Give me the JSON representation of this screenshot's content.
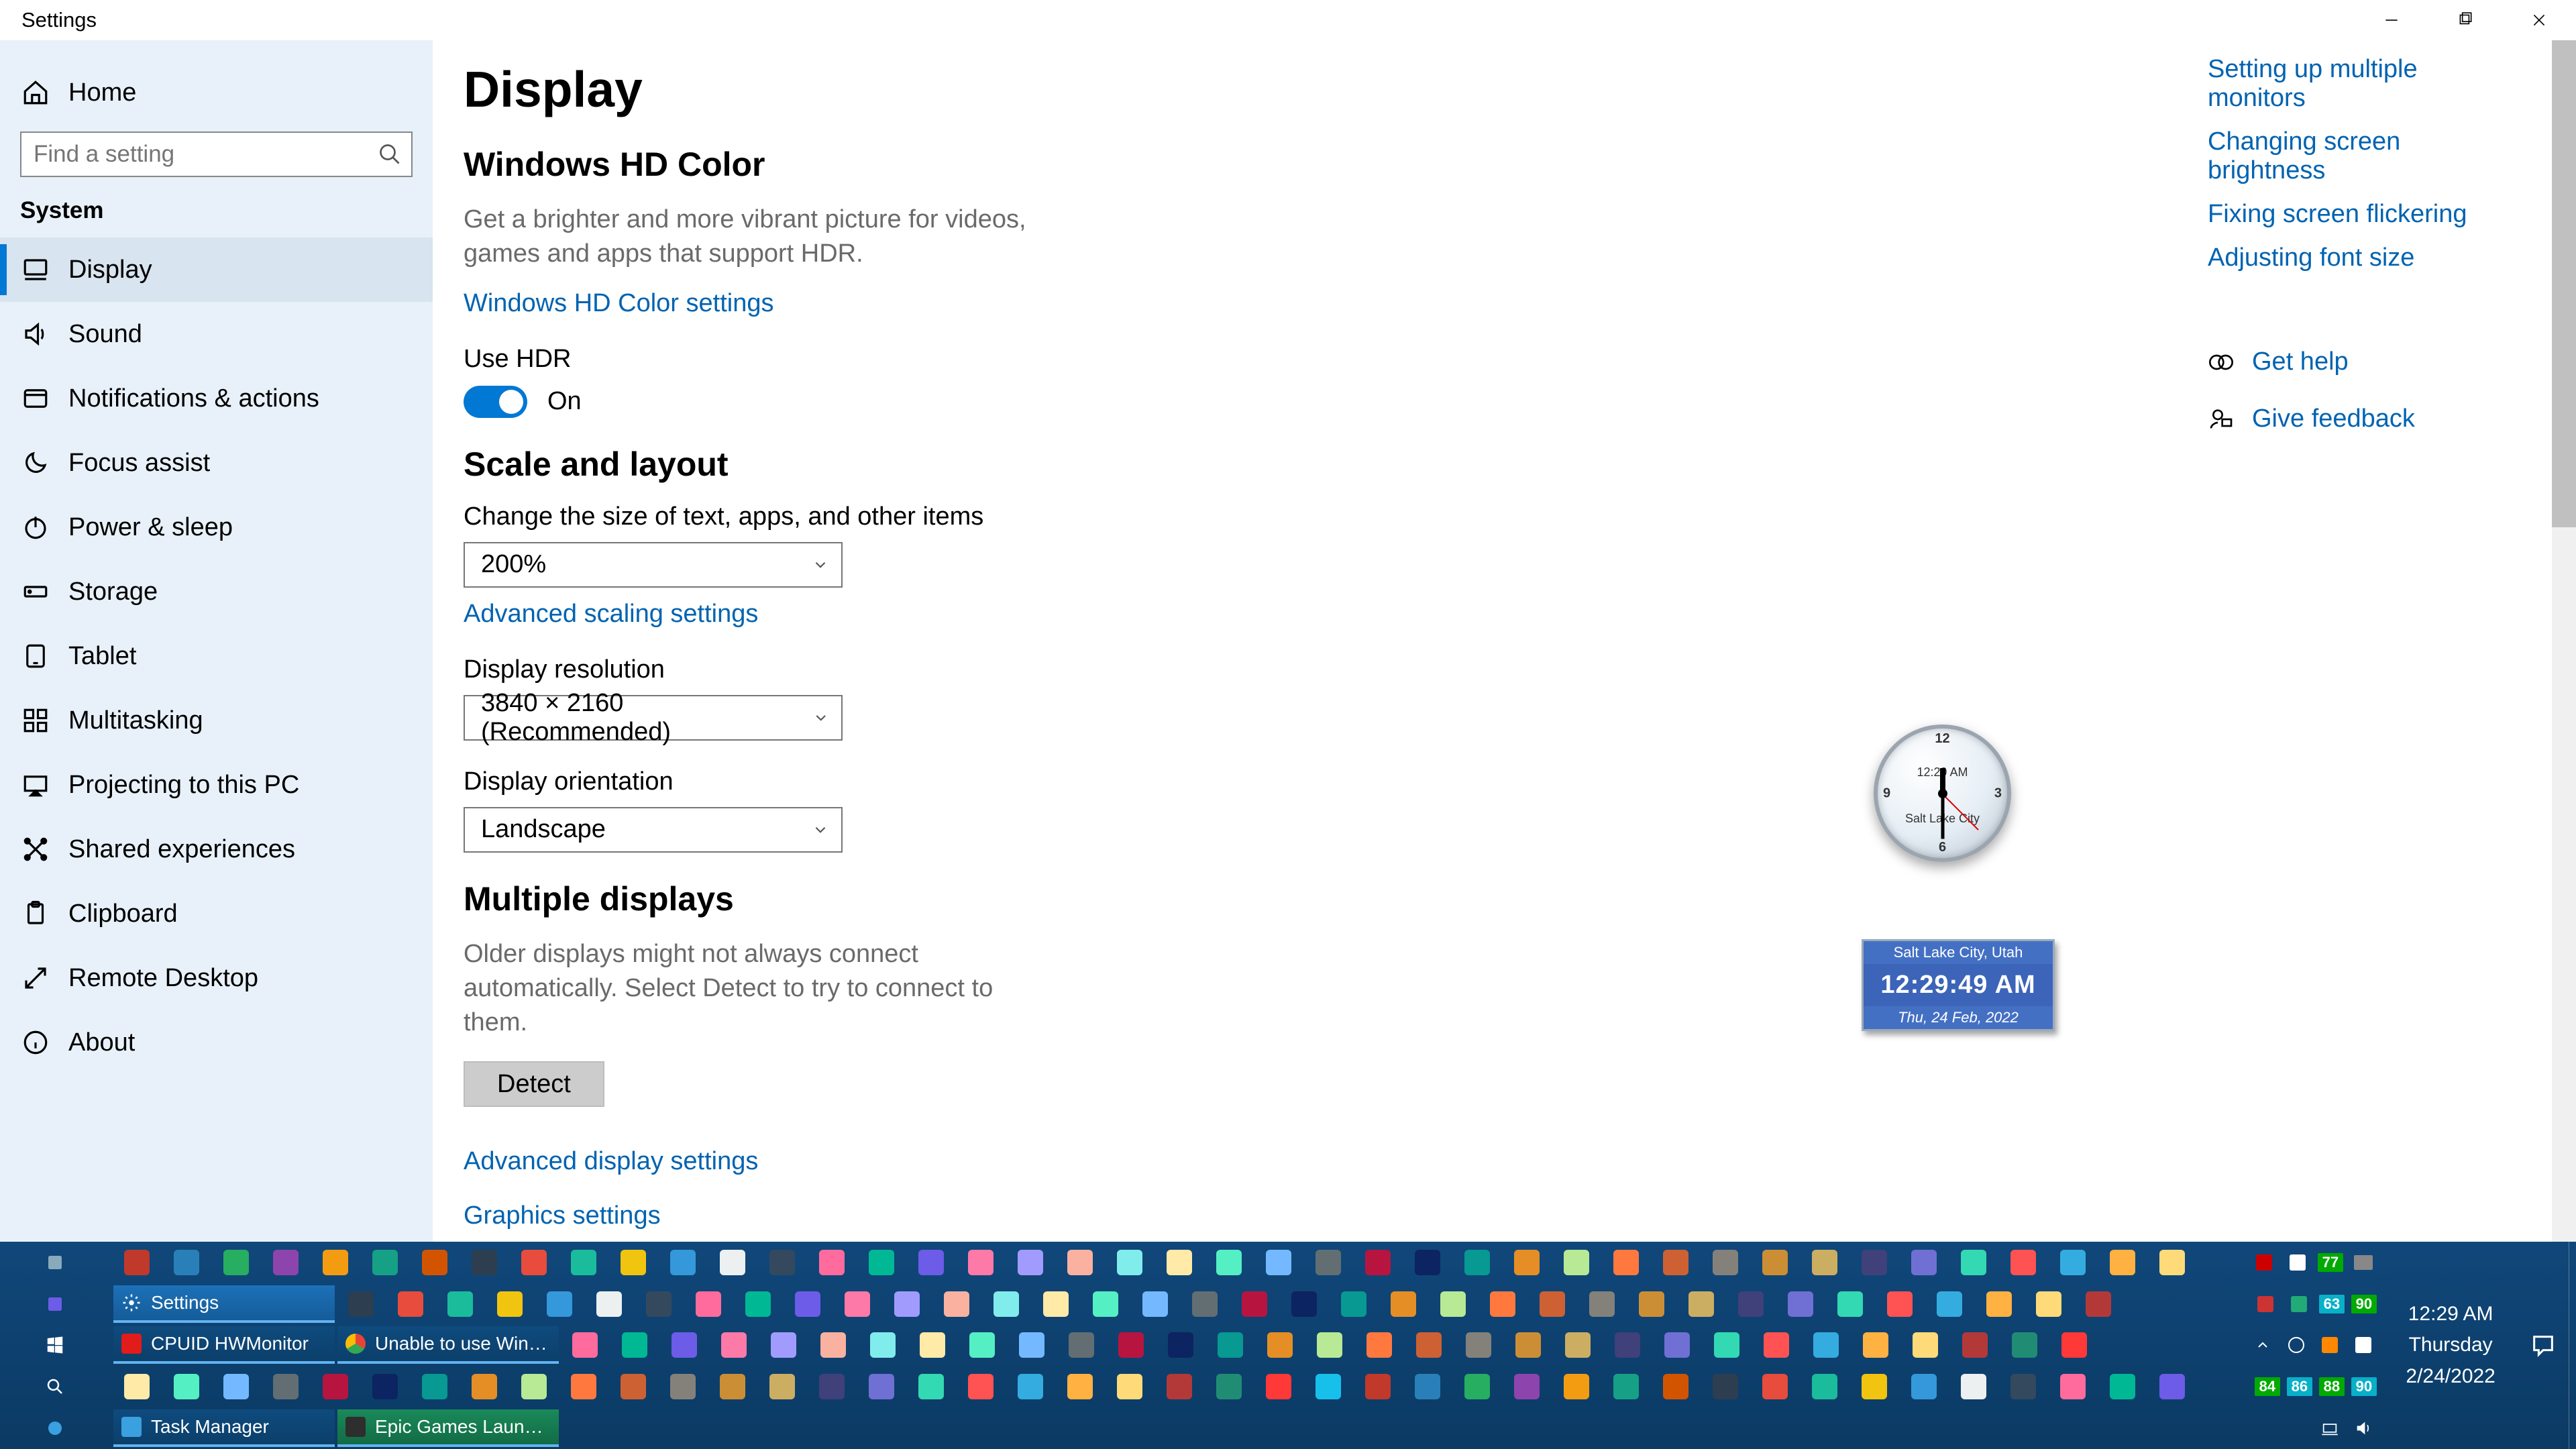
{
  "window": {
    "title": "Settings"
  },
  "sidebar": {
    "home": "Home",
    "search_placeholder": "Find a setting",
    "section": "System",
    "items": [
      {
        "label": "Display",
        "icon": "monitor",
        "active": true
      },
      {
        "label": "Sound",
        "icon": "sound"
      },
      {
        "label": "Notifications & actions",
        "icon": "notifications"
      },
      {
        "label": "Focus assist",
        "icon": "moon"
      },
      {
        "label": "Power & sleep",
        "icon": "power"
      },
      {
        "label": "Storage",
        "icon": "storage"
      },
      {
        "label": "Tablet",
        "icon": "tablet"
      },
      {
        "label": "Multitasking",
        "icon": "multitasking"
      },
      {
        "label": "Projecting to this PC",
        "icon": "projecting"
      },
      {
        "label": "Shared experiences",
        "icon": "shared"
      },
      {
        "label": "Clipboard",
        "icon": "clipboard"
      },
      {
        "label": "Remote Desktop",
        "icon": "remote"
      },
      {
        "label": "About",
        "icon": "info"
      }
    ]
  },
  "page": {
    "title": "Display",
    "hdr": {
      "heading": "Windows HD Color",
      "desc": "Get a brighter and more vibrant picture for videos, games and apps that support HDR.",
      "link": "Windows HD Color settings",
      "toggle_label": "Use HDR",
      "toggle_state": "On"
    },
    "scale": {
      "heading": "Scale and layout",
      "size_label": "Change the size of text, apps, and other items",
      "size_value": "200%",
      "adv_scaling": "Advanced scaling settings",
      "res_label": "Display resolution",
      "res_value": "3840 × 2160 (Recommended)",
      "orient_label": "Display orientation",
      "orient_value": "Landscape"
    },
    "multi": {
      "heading": "Multiple displays",
      "desc": "Older displays might not always connect automatically. Select Detect to try to connect to them.",
      "detect": "Detect",
      "adv_display": "Advanced display settings",
      "graphics": "Graphics settings"
    }
  },
  "rightcol": {
    "links": [
      "Setting up multiple monitors",
      "Changing screen brightness",
      "Fixing screen flickering",
      "Adjusting font size"
    ],
    "help": "Get help",
    "feedback": "Give feedback"
  },
  "gadget": {
    "analog_time": "12:29 AM",
    "analog_city": "Salt Lake City",
    "digital_city": "Salt Lake City, Utah",
    "digital_time": "12:29:49 AM",
    "digital_date": "Thu, 24 Feb, 2022"
  },
  "taskbar": {
    "apps": {
      "row1": [
        {
          "label": "CPUID HWMonitor",
          "color": "#e21b1b"
        },
        {
          "label": "Unable to use Windo...",
          "color": "#f2c94c"
        }
      ],
      "row2": [
        {
          "label": "Settings",
          "color": "#ffffff"
        }
      ],
      "row4": [
        {
          "label": "Task Manager",
          "color": "#3aa0e0"
        },
        {
          "label": "Epic Games Launcher",
          "color": "#2e2e2e"
        }
      ]
    },
    "tray_badges": {
      "row1": [
        "84",
        "86",
        "88",
        "90"
      ],
      "row2": [
        "84",
        "86",
        "88",
        "90"
      ],
      "row0": [
        "77"
      ]
    },
    "clock": {
      "time": "12:29 AM",
      "day": "Thursday",
      "date": "2/24/2022"
    }
  }
}
